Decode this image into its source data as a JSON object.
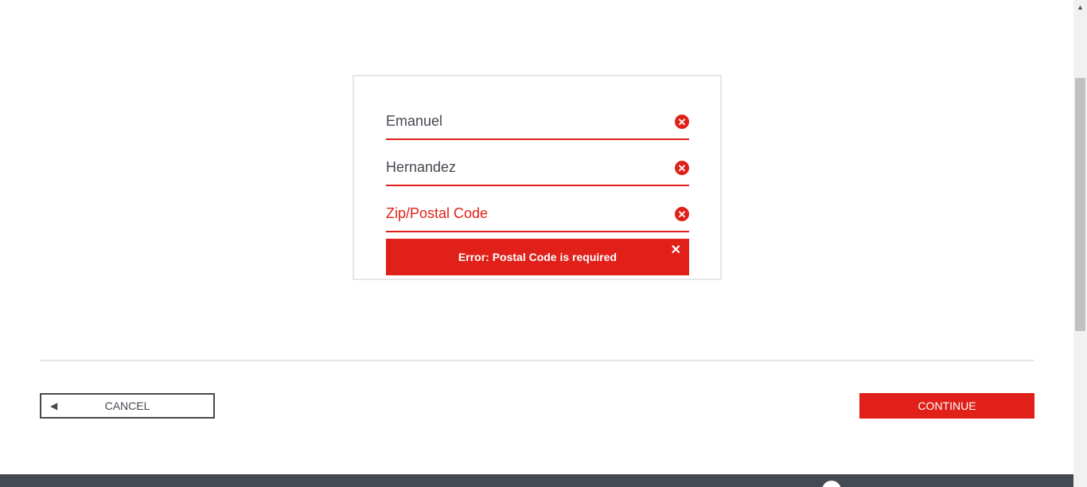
{
  "form": {
    "first_name": {
      "value": "Emanuel"
    },
    "last_name": {
      "value": "Hernandez"
    },
    "postal_code": {
      "value": "",
      "placeholder": "Zip/Postal Code"
    },
    "error": {
      "message": "Error: Postal Code is required",
      "close_glyph": "✕"
    },
    "clear_glyph": "✕"
  },
  "actions": {
    "cancel_arrow": "◀",
    "cancel_label": "CANCEL",
    "continue_label": "CONTINUE"
  },
  "colors": {
    "accent": "#e02019",
    "text_dark": "#444a51",
    "border_light": "#e6e6e6",
    "footer": "#444a51"
  },
  "icons": {
    "clear": "clear-field-icon",
    "close": "close-icon",
    "back": "back-arrow-icon"
  }
}
